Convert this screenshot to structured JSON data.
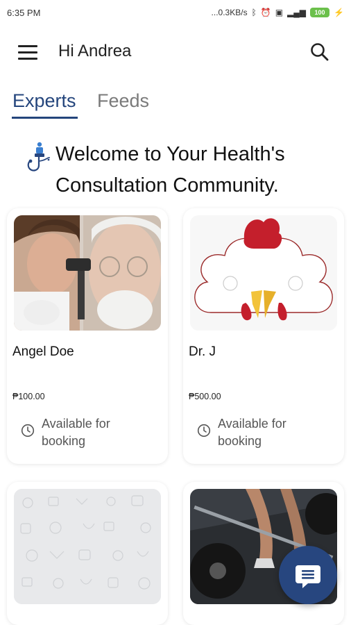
{
  "status_bar": {
    "time": "6:35 PM",
    "network_speed": "...0.3KB/s",
    "battery": "100",
    "icons": [
      "bluetooth-icon",
      "alarm-icon",
      "sim-icon",
      "signal-icon",
      "battery-icon",
      "charging-icon"
    ]
  },
  "header": {
    "greeting": "Hi Andrea",
    "menu_icon": "menu-icon",
    "search_icon": "search-icon"
  },
  "tabs": [
    {
      "label": "Experts",
      "active": true
    },
    {
      "label": "Feeds",
      "active": false
    }
  ],
  "welcome": {
    "line1": "Welcome to Your Health's",
    "line2": "Consultation Community.",
    "logo_icon": "health-logo-icon"
  },
  "experts": [
    {
      "name": "Angel Doe",
      "price": "₱100.00",
      "availability": "Available for booking",
      "image": "doctor-examining-patient-photo"
    },
    {
      "name": "Dr. J",
      "price": "₱500.00",
      "availability": "Available for booking",
      "image": "chicken-mascot-illustration"
    },
    {
      "name": "",
      "price": "",
      "availability": "",
      "image": "doodle-pattern-placeholder"
    },
    {
      "name": "",
      "price": "",
      "availability": "",
      "image": "weightlifting-photo"
    }
  ],
  "fab": {
    "icon": "chat-icon"
  },
  "colors": {
    "accent": "#24457c",
    "fab": "#27467f",
    "tab_inactive": "#7a7a7a",
    "battery": "#6bc04b"
  }
}
